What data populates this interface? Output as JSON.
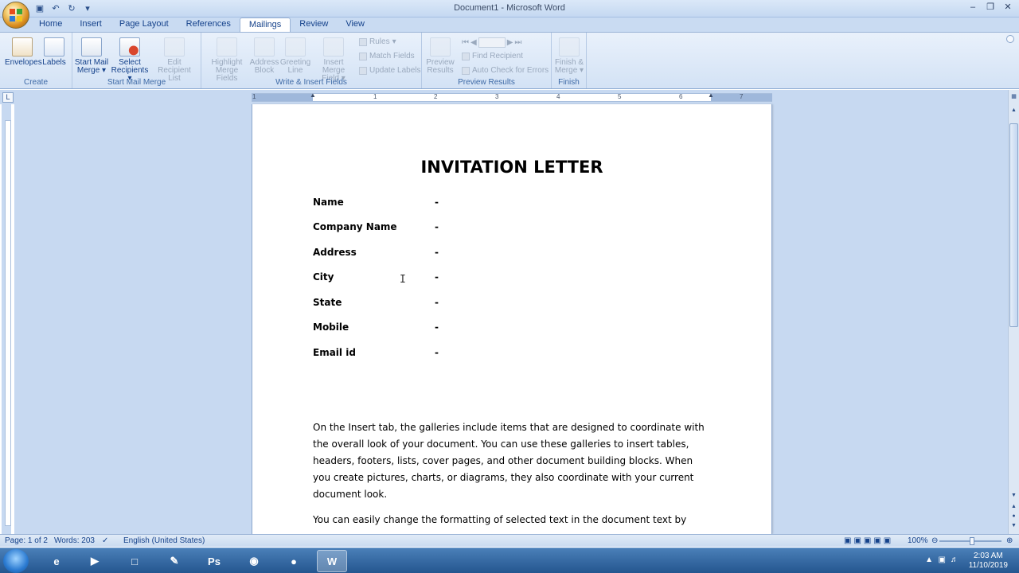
{
  "window": {
    "title": "Document1 - Microsoft Word"
  },
  "ribbon": {
    "tabs": [
      "Home",
      "Insert",
      "Page Layout",
      "References",
      "Mailings",
      "Review",
      "View"
    ],
    "active_tab": "Mailings",
    "groups": {
      "create": {
        "label": "Create",
        "envelopes": "Envelopes",
        "labels": "Labels"
      },
      "start_mail_merge": {
        "label": "Start Mail Merge",
        "start_l1": "Start Mail",
        "start_l2": "Merge",
        "select_l1": "Select",
        "select_l2": "Recipients",
        "edit_l1": "Edit",
        "edit_l2": "Recipient List"
      },
      "write_insert": {
        "label": "Write & Insert Fields",
        "highlight_l1": "Highlight",
        "highlight_l2": "Merge Fields",
        "address_l1": "Address",
        "address_l2": "Block",
        "greeting_l1": "Greeting",
        "greeting_l2": "Line",
        "insert_l1": "Insert Merge",
        "insert_l2": "Field",
        "rules": "Rules",
        "match": "Match Fields",
        "update": "Update Labels"
      },
      "preview": {
        "label": "Preview Results",
        "preview_l1": "Preview",
        "preview_l2": "Results",
        "find": "Find Recipient",
        "auto": "Auto Check for Errors"
      },
      "finish": {
        "label": "Finish",
        "finish_l1": "Finish &",
        "finish_l2": "Merge"
      }
    }
  },
  "ruler": {
    "numbers": [
      "1",
      "1",
      "2",
      "3",
      "4",
      "5",
      "6",
      "7"
    ]
  },
  "document": {
    "title": "INVITATION LETTER",
    "fields": [
      {
        "label": "Name",
        "value": "-"
      },
      {
        "label": "Company Name",
        "value": "-"
      },
      {
        "label": "Address",
        "value": "-"
      },
      {
        "label": "City",
        "value": "-"
      },
      {
        "label": "State",
        "value": "-"
      },
      {
        "label": "Mobile",
        "value": "-"
      },
      {
        "label": "Email id",
        "value": "-"
      }
    ],
    "para1": [
      "On the Insert tab, the galleries include items that are designed to coordinate with",
      "the overall look of your document. You can use these galleries to insert tables,",
      "headers, footers, lists,  cover pages, and other document building blocks. When",
      "you create pictures, charts, or diagrams, they also coordinate with your current",
      "document look."
    ],
    "para2": "You can easily change the formatting of selected  text in the document text by"
  },
  "status": {
    "page": "Page: 1 of 2",
    "words": "Words: 203",
    "language": "English (United States)",
    "zoom": "100%"
  },
  "taskbar": {
    "time": "2:03 AM",
    "date": "11/10/2019"
  }
}
